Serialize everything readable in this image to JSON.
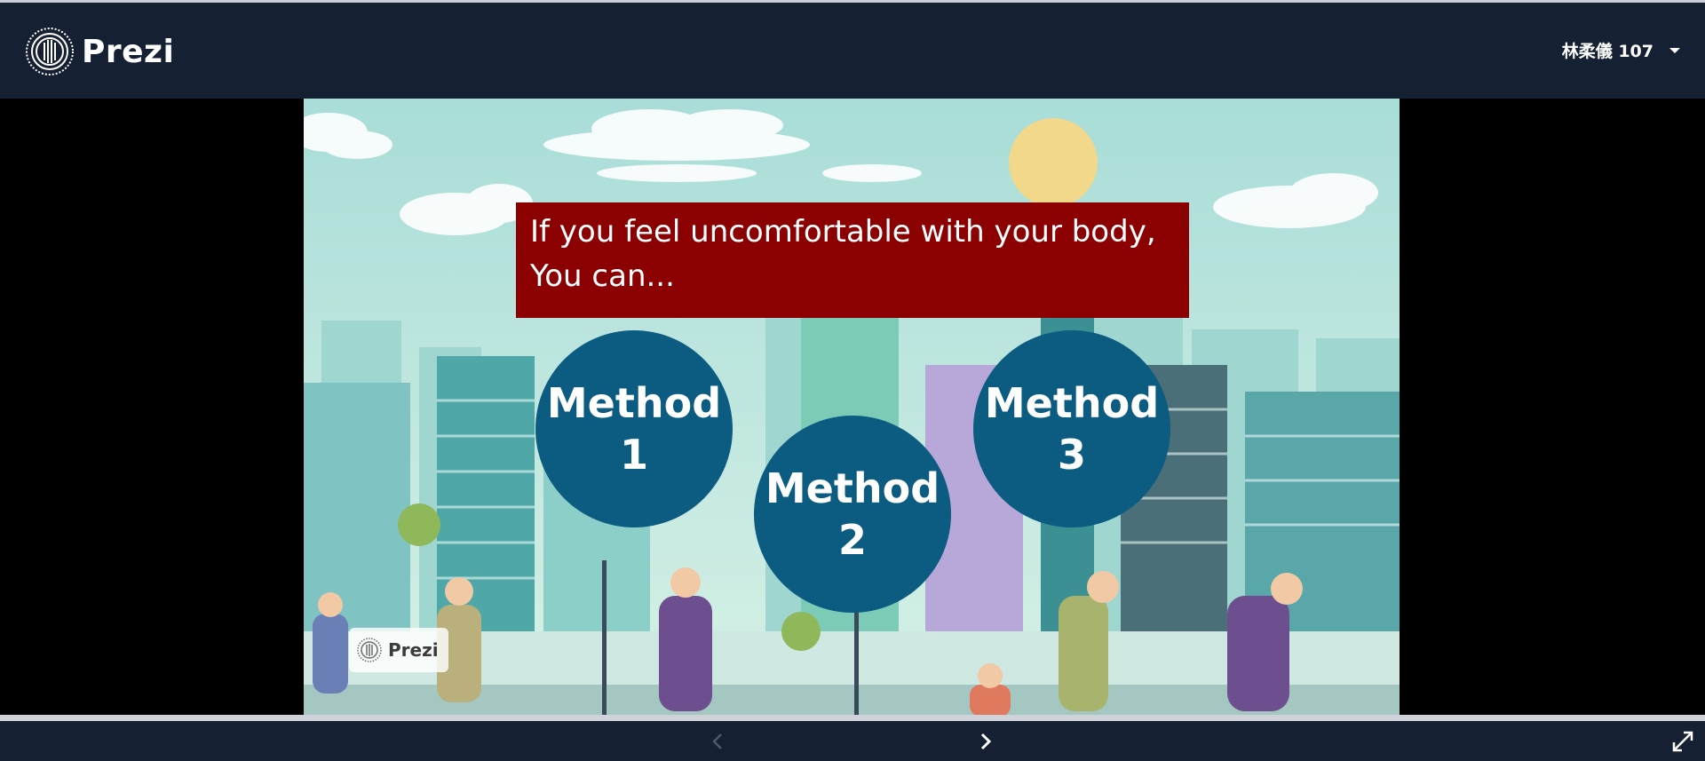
{
  "app": {
    "brand": "Prezi"
  },
  "header": {
    "user_name": "林柔儀 107"
  },
  "slide": {
    "title_lines": [
      "If you feel uncomfortable with your body,",
      "You can..."
    ],
    "methods": [
      {
        "word": "Method",
        "number": "1"
      },
      {
        "word": "Method",
        "number": "2"
      },
      {
        "word": "Method",
        "number": "3"
      }
    ],
    "watermark": "Prezi"
  },
  "colors": {
    "topbar": "#162033",
    "title_box": "#8b0000",
    "method_circle": "#0b5c80",
    "sky": "#b9e4de"
  },
  "icons": {
    "logo": "prezi-logo-icon",
    "user_menu": "chevron-down-icon",
    "prev": "chevron-left-icon",
    "next": "chevron-right-icon",
    "fullscreen": "expand-icon"
  }
}
